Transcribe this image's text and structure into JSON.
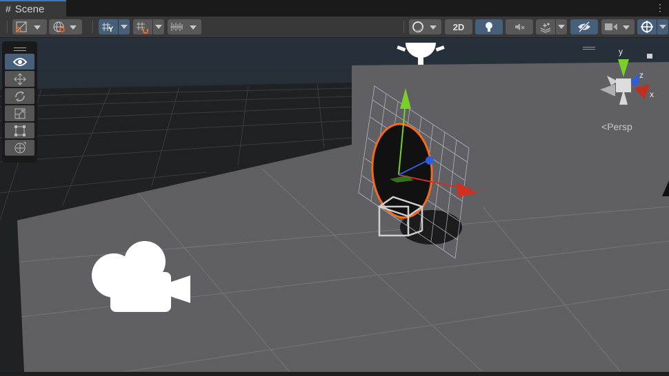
{
  "tab": {
    "title": "Scene",
    "icon": "grid-hash-icon"
  },
  "toolbar": {
    "left": [
      {
        "name": "draw-mode-button",
        "icon": "shading-icon"
      },
      {
        "name": "global-local-button",
        "icon": "globe-icon"
      },
      {
        "name": "grid-visibility-button",
        "icon": "grid-y-icon",
        "active": true
      },
      {
        "name": "grid-snapping-button",
        "icon": "magnet-icon"
      },
      {
        "name": "increment-snap-button",
        "icon": "ruler-icon"
      }
    ],
    "two_d_label": "2D",
    "right": [
      {
        "name": "render-mode-button",
        "icon": "sphere-icon"
      },
      {
        "name": "lighting-button",
        "icon": "bulb-icon",
        "active": true
      },
      {
        "name": "audio-button",
        "icon": "mute-icon"
      },
      {
        "name": "effects-button",
        "icon": "layers-icon"
      },
      {
        "name": "hidden-objects-button",
        "icon": "eye-slash-icon",
        "active": true
      },
      {
        "name": "camera-button",
        "icon": "camera-icon"
      },
      {
        "name": "gizmos-button",
        "icon": "gizmo-icon",
        "active": true
      }
    ]
  },
  "tools": [
    "view",
    "move",
    "rotate",
    "scale",
    "rect",
    "transform"
  ],
  "gizmo": {
    "x": "x",
    "y": "y",
    "z": "z",
    "projection": "Persp"
  },
  "colors": {
    "accent": "#46607c",
    "x_axis": "#d03020",
    "y_axis": "#7ad02a",
    "z_axis": "#2c5fe0",
    "selection": "#f36b1c"
  }
}
